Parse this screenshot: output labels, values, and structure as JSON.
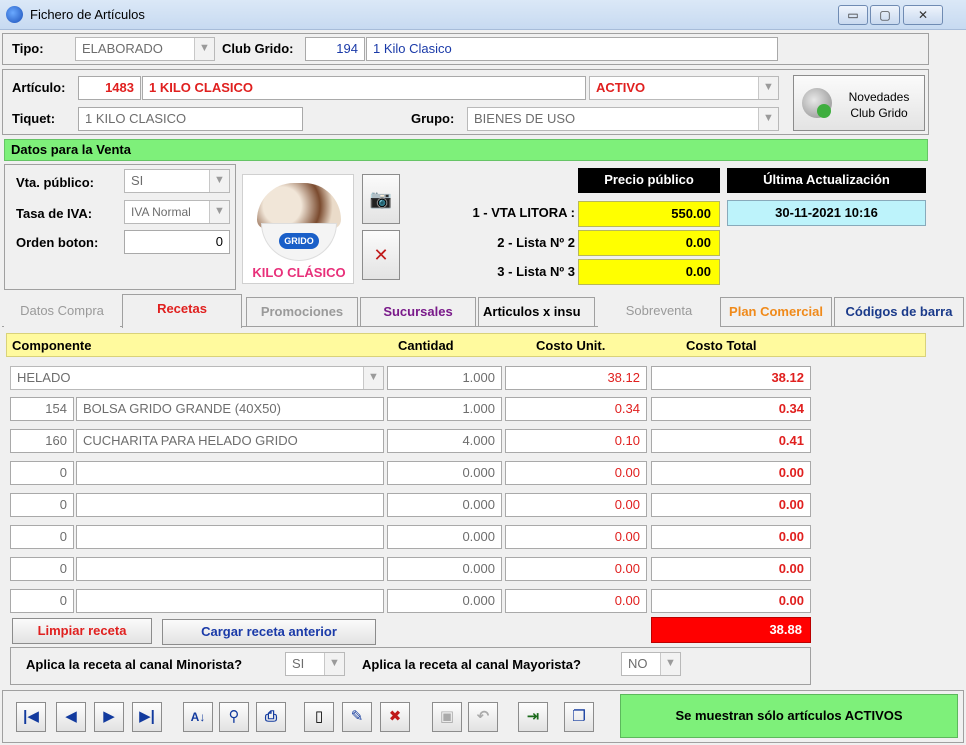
{
  "window": {
    "title": "Fichero de Artículos",
    "min": "▭",
    "max": "▢",
    "close": "✕"
  },
  "header": {
    "tipo_label": "Tipo:",
    "tipo_value": "ELABORADO",
    "club_label": "Club Grido:",
    "club_code": "194",
    "club_name": "1 Kilo Clasico"
  },
  "articulo": {
    "label": "Artículo:",
    "code": "1483",
    "name": "1 KILO CLASICO",
    "status": "ACTIVO",
    "tiquet_label": "Tiquet:",
    "tiquet_value": "1 KILO CLASICO",
    "grupo_label": "Grupo:",
    "grupo_value": "BIENES DE USO",
    "novedades_line1": "Novedades",
    "novedades_line2": "Club Grido"
  },
  "venta": {
    "section_title": "Datos para la Venta",
    "vta_publico_label": "Vta. público:",
    "vta_publico_value": "SI",
    "iva_label": "Tasa de IVA:",
    "iva_value": "IVA Normal",
    "orden_label": "Orden boton:",
    "orden_value": "0",
    "image_brand": "GRIDO",
    "image_caption": "KILO CLÁSICO",
    "precio_header": "Precio público",
    "actualizacion_header": "Última Actualización",
    "actualizacion_value": "30-11-2021 10:16",
    "precios": [
      {
        "label": "1 - VTA LITORA :",
        "value": "550.00"
      },
      {
        "label": "2 - Lista Nº 2",
        "value": "0.00"
      },
      {
        "label": "3 - Lista Nº 3",
        "value": "0.00"
      }
    ]
  },
  "tabs": [
    {
      "label": "Datos Compra",
      "color": "#9a9a9a"
    },
    {
      "label": "Recetas",
      "color": "#e0201f"
    },
    {
      "label": "Promociones",
      "color": "#9a9a9a"
    },
    {
      "label": "Sucursales",
      "color": "#7a1a8a"
    },
    {
      "label": "Articulos x insu",
      "color": "#000000"
    },
    {
      "label": "Sobreventa",
      "color": "#9a9a9a"
    },
    {
      "label": "Plan Comercial",
      "color": "#f08a1a"
    },
    {
      "label": "Códigos de barra",
      "color": "#1a3a8a"
    }
  ],
  "recetas": {
    "headers": {
      "componente": "Componente",
      "cantidad": "Cantidad",
      "costo_unit": "Costo Unit.",
      "costo_total": "Costo Total"
    },
    "first_row": {
      "componente": "HELADO",
      "cantidad": "1.000",
      "costo_unit": "38.12",
      "costo_total": "38.12"
    },
    "rows": [
      {
        "code": "154",
        "name": "BOLSA GRIDO GRANDE (40X50)",
        "cantidad": "1.000",
        "costo_unit": "0.34",
        "costo_total": "0.34"
      },
      {
        "code": "160",
        "name": "CUCHARITA PARA HELADO GRIDO",
        "cantidad": "4.000",
        "costo_unit": "0.10",
        "costo_total": "0.41"
      },
      {
        "code": "0",
        "name": "",
        "cantidad": "0.000",
        "costo_unit": "0.00",
        "costo_total": "0.00"
      },
      {
        "code": "0",
        "name": "",
        "cantidad": "0.000",
        "costo_unit": "0.00",
        "costo_total": "0.00"
      },
      {
        "code": "0",
        "name": "",
        "cantidad": "0.000",
        "costo_unit": "0.00",
        "costo_total": "0.00"
      },
      {
        "code": "0",
        "name": "",
        "cantidad": "0.000",
        "costo_unit": "0.00",
        "costo_total": "0.00"
      },
      {
        "code": "0",
        "name": "",
        "cantidad": "0.000",
        "costo_unit": "0.00",
        "costo_total": "0.00"
      }
    ],
    "limpiar_label": "Limpiar receta",
    "cargar_label": "Cargar receta anterior",
    "total": "38.88",
    "minorista_label": "Aplica la receta al canal Minorista?",
    "minorista_value": "SI",
    "mayorista_label": "Aplica la receta al canal Mayorista?",
    "mayorista_value": "NO"
  },
  "footer": {
    "status_label": "Se muestran sólo artículos ACTIVOS"
  },
  "colors": {
    "green": "#7ef07a",
    "yellow": "#ffff00",
    "red": "#ff0000",
    "cyan": "#bdf3fb"
  }
}
